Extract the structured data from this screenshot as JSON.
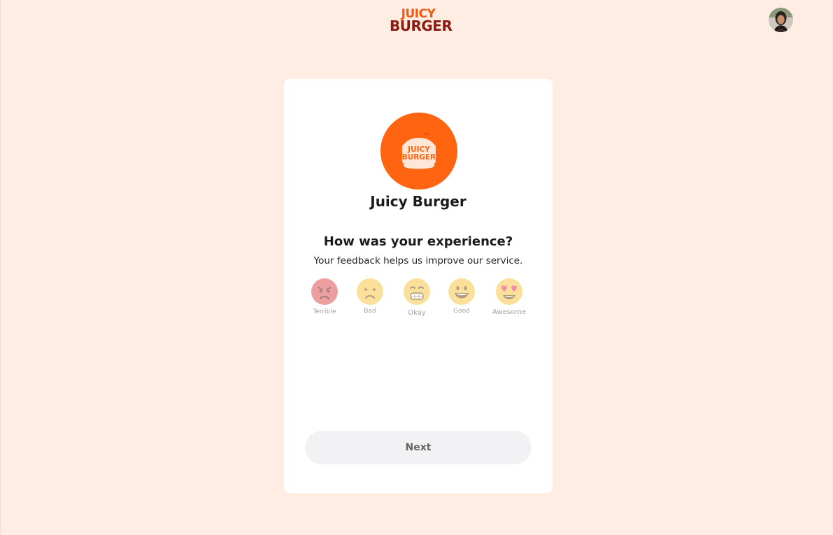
{
  "header": {
    "logo_line1": "JUICY",
    "logo_line2": "BURGER",
    "avatar_icon": "user-avatar-photo"
  },
  "card": {
    "logo_icon": "burger-logo-icon",
    "logo_text_line1": "JUICY",
    "logo_text_line2": "BURGER",
    "restaurant_name": "Juicy Burger",
    "question": "How was your experience?",
    "subtext": "Your feedback helps us improve our service.",
    "ratings": [
      {
        "label": "Terrible",
        "icon": "angry-face-icon"
      },
      {
        "label": "Bad",
        "icon": "frowning-face-icon"
      },
      {
        "label": "Okay",
        "icon": "grimacing-face-icon"
      },
      {
        "label": "Good",
        "icon": "smiling-face-icon"
      },
      {
        "label": "Awesome",
        "icon": "heart-eyes-face-icon"
      }
    ],
    "next_label": "Next"
  },
  "colors": {
    "background": "#FFECE2",
    "brand_orange": "#FF6411",
    "brand_dark_red": "#8B1A10",
    "button_bg": "#F2F2F4"
  }
}
